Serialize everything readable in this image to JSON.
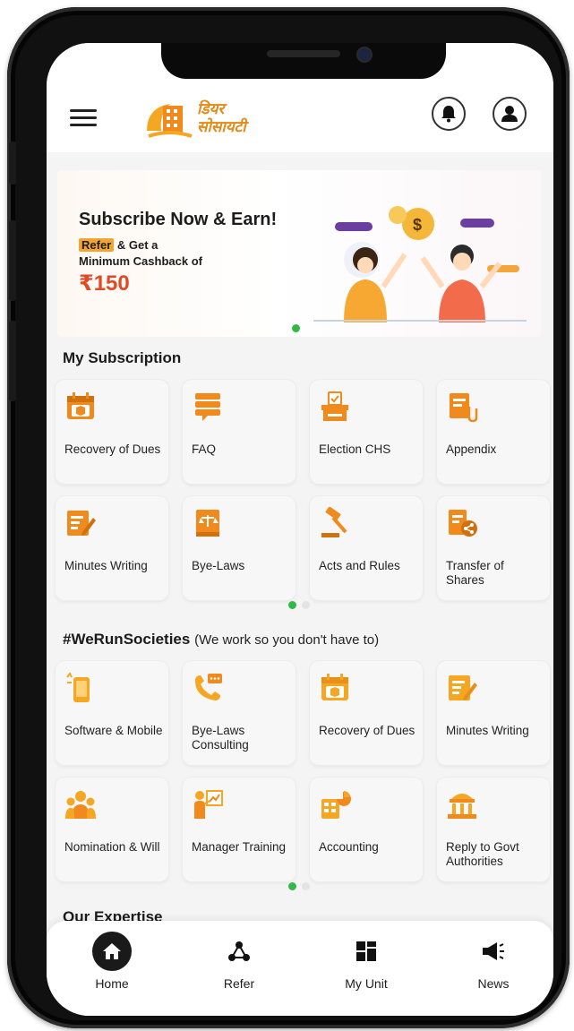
{
  "header": {
    "logo_line1": "डियर",
    "logo_line2": "सोसायटी"
  },
  "banner": {
    "title": "Subscribe Now & Earn!",
    "refer_highlight": "Refer",
    "refer_rest": "& Get a",
    "line2": "Minimum Cashback of",
    "amount": "₹150"
  },
  "my_subscription": {
    "title": "My Subscription",
    "items": [
      {
        "label": "Recovery of Dues",
        "icon": "calendar-box-icon"
      },
      {
        "label": "FAQ",
        "icon": "faq-stack-icon"
      },
      {
        "label": "Election CHS",
        "icon": "ballot-box-icon"
      },
      {
        "label": "Appendix",
        "icon": "document-clip-icon"
      },
      {
        "label": "Minutes Writing",
        "icon": "document-pen-icon"
      },
      {
        "label": "Bye-Laws",
        "icon": "law-book-icon"
      },
      {
        "label": "Acts and Rules",
        "icon": "gavel-icon"
      },
      {
        "label": "Transfer of Shares",
        "icon": "share-document-icon"
      }
    ]
  },
  "we_run": {
    "title": "#WeRunSocieties",
    "subtitle": "(We work so you don't have to)",
    "items": [
      {
        "label": "Software & Mobile",
        "icon": "mobile-software-icon"
      },
      {
        "label": "Bye-Laws Consulting",
        "icon": "phone-consult-icon"
      },
      {
        "label": "Recovery of Dues",
        "icon": "calendar-box-icon"
      },
      {
        "label": "Minutes Writing",
        "icon": "document-pen-icon"
      },
      {
        "label": "Nomination & Will",
        "icon": "family-icon"
      },
      {
        "label": "Manager Training",
        "icon": "trainer-board-icon"
      },
      {
        "label": "Accounting",
        "icon": "accounting-chart-icon"
      },
      {
        "label": "Reply to Govt Authorities",
        "icon": "government-building-icon"
      }
    ]
  },
  "expertise_title": "Our Expertise",
  "nav": {
    "home": "Home",
    "refer": "Refer",
    "my_unit": "My Unit",
    "news": "News"
  },
  "colors": {
    "accent": "#f08a1c",
    "amount": "#e04a25",
    "dot_active": "#31b947"
  }
}
